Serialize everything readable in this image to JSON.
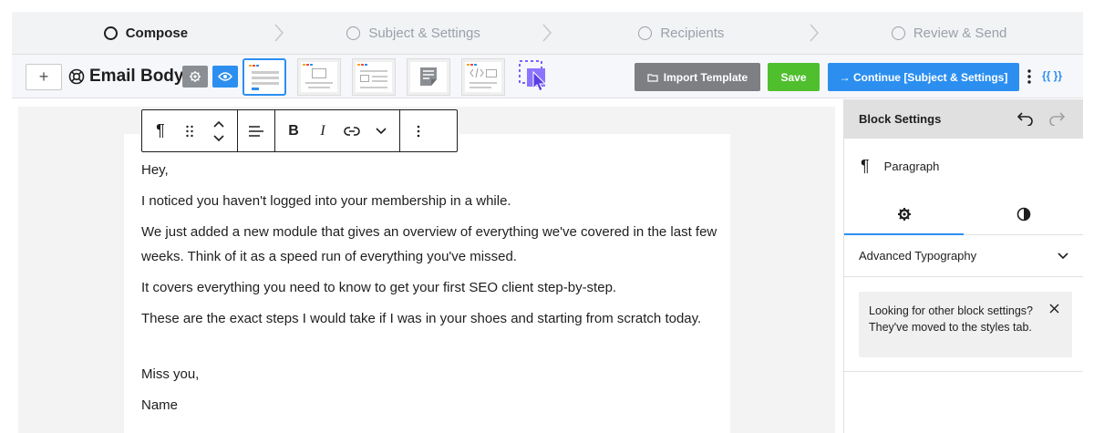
{
  "steps": [
    {
      "label": "Compose",
      "active": true
    },
    {
      "label": "Subject & Settings",
      "active": false
    },
    {
      "label": "Recipients",
      "active": false
    },
    {
      "label": "Review & Send",
      "active": false
    }
  ],
  "toolbar": {
    "add_label": "+",
    "title": "Email Body",
    "import_label": "Import Template",
    "save_label": "Save",
    "continue_label": "→ Continue [Subject & Settings]",
    "merge_tags_label": "{{ }}"
  },
  "block_toolbar": {
    "paragraph_glyph": "¶",
    "bold_glyph": "B",
    "italic_glyph": "I"
  },
  "email_body": {
    "paragraphs": [
      "Hey,",
      "I noticed you haven't logged into your membership in a while.",
      "We just added a new module that gives an overview of everything we've covered in the last few weeks. Think of it as a speed run of everything you've missed.",
      "It covers everything you need to know to get your first SEO client step-by-step.",
      "These are the exact steps I would take if I was in your shoes and starting from scratch today.",
      "Miss you,",
      "Name"
    ]
  },
  "sidebar": {
    "header": "Block Settings",
    "block_glyph": "¶",
    "block_name": "Paragraph",
    "section_title": "Advanced Typography",
    "notice": "Looking for other block settings? They've moved to the styles tab."
  },
  "colors": {
    "accent": "#2c8ff0",
    "save_green": "#4fbf2e",
    "import_gray": "#7d7f83"
  }
}
